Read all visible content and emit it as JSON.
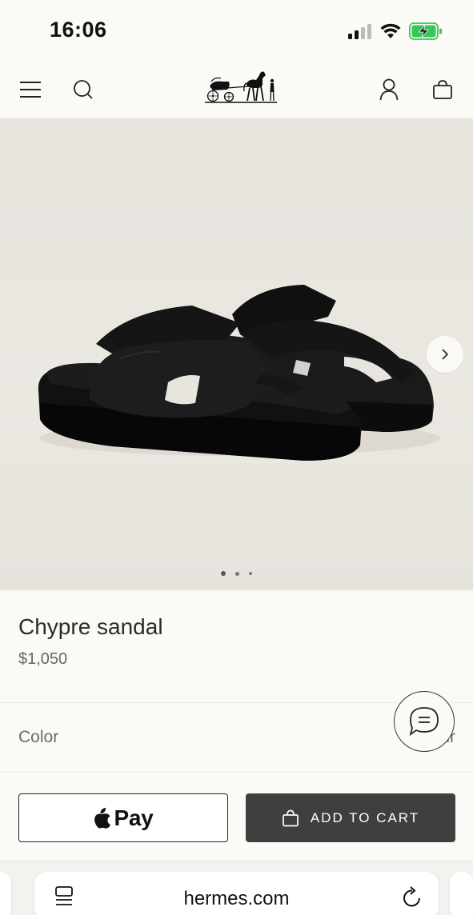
{
  "status_bar": {
    "time": "16:06",
    "icons": [
      "signal-icon",
      "wifi-icon",
      "battery-charging-icon"
    ]
  },
  "header": {
    "left_icons": [
      "menu-icon",
      "search-icon"
    ],
    "logo": "hermes-carriage-logo",
    "right_icons": [
      "account-icon",
      "shopping-bag-icon"
    ]
  },
  "gallery": {
    "next_icon": "chevron-right-icon",
    "slide_count": 3,
    "active_slide": 1
  },
  "product": {
    "name": "Chypre sandal",
    "price": "$1,050"
  },
  "options": {
    "color_label": "Color",
    "color_value": "Noir"
  },
  "chat": {
    "icon": "chat-bubble-icon"
  },
  "actions": {
    "applepay_label": "Pay",
    "add_to_cart_label": "ADD TO CART"
  },
  "browser": {
    "url": "hermes.com",
    "left_icon": "tabs-icon",
    "right_icon": "reload-icon"
  },
  "colors": {
    "page_bg": "#fcfaf6",
    "hero_bg": "#e9e6e0",
    "button_dark": "#3f3f3f"
  }
}
